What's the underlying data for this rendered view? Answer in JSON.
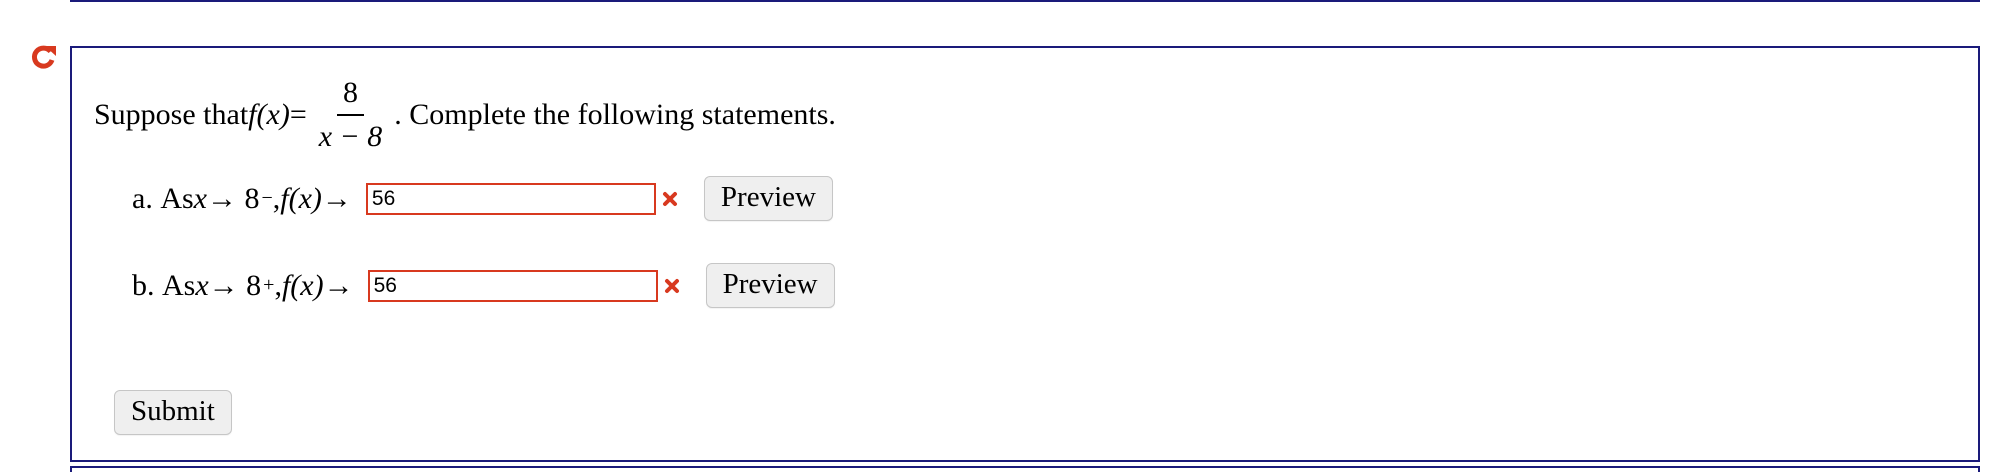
{
  "question": {
    "intro_prefix": "Suppose that ",
    "func": "f(x)",
    "equals": " = ",
    "numerator": "8",
    "denominator": "x − 8",
    "intro_suffix": ". Complete the following statements."
  },
  "parts": [
    {
      "label": "a.",
      "as_text": "As ",
      "var": "x",
      "arrow1": " → 8",
      "direction": "−",
      "comma": " , ",
      "func": "f(x)",
      "arrow2": " →",
      "answer_value": "56",
      "status_icon": "x-mark-icon",
      "preview_label": "Preview"
    },
    {
      "label": "b.",
      "as_text": "As ",
      "var": "x",
      "arrow1": " → 8",
      "direction": "+",
      "comma": ", ",
      "func": "f(x)",
      "arrow2": " →",
      "answer_value": "56",
      "status_icon": "x-mark-icon",
      "preview_label": "Preview"
    }
  ],
  "submit_label": "Submit",
  "colors": {
    "frame": "#1a1a7a",
    "error": "#d8391f",
    "retry_icon": "#d8391f"
  }
}
